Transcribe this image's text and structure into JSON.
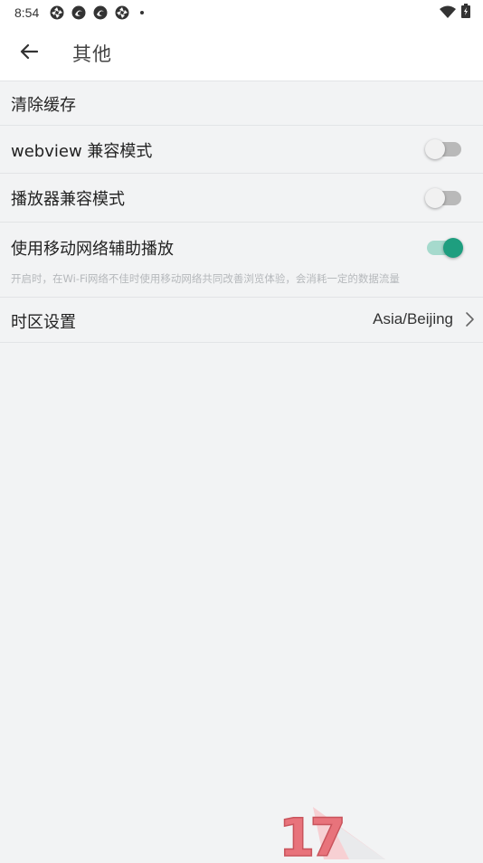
{
  "status_bar": {
    "time": "8:54",
    "left_icons": [
      "aperture-icon",
      "swirl-icon",
      "swirl-icon",
      "aperture-icon",
      "dot-icon"
    ],
    "right_icons": [
      "wifi-icon",
      "battery-icon"
    ]
  },
  "header": {
    "title": "其他",
    "back_icon": "arrow-left-icon"
  },
  "settings": {
    "clear_cache": {
      "label": "清除缓存"
    },
    "webview_compat": {
      "label": "webview 兼容模式",
      "enabled": false
    },
    "player_compat": {
      "label": "播放器兼容模式",
      "enabled": false
    },
    "mobile_assist": {
      "label": "使用移动网络辅助播放",
      "enabled": true,
      "description": "开启时，在Wi-Fi网络不佳时使用移动网络共同改善浏览体验，会消耗一定的数据流量"
    },
    "timezone": {
      "label": "时区设置",
      "value": "Asia/Beijing",
      "chevron_icon": "chevron-right-icon"
    }
  },
  "watermark": {
    "text": "17"
  },
  "colors": {
    "accent": "#1e9e7f",
    "accent_track": "#a6dacd",
    "switch_off_track": "#b9b9b9",
    "background": "#f2f3f4",
    "watermark_red": "#e8737b"
  }
}
